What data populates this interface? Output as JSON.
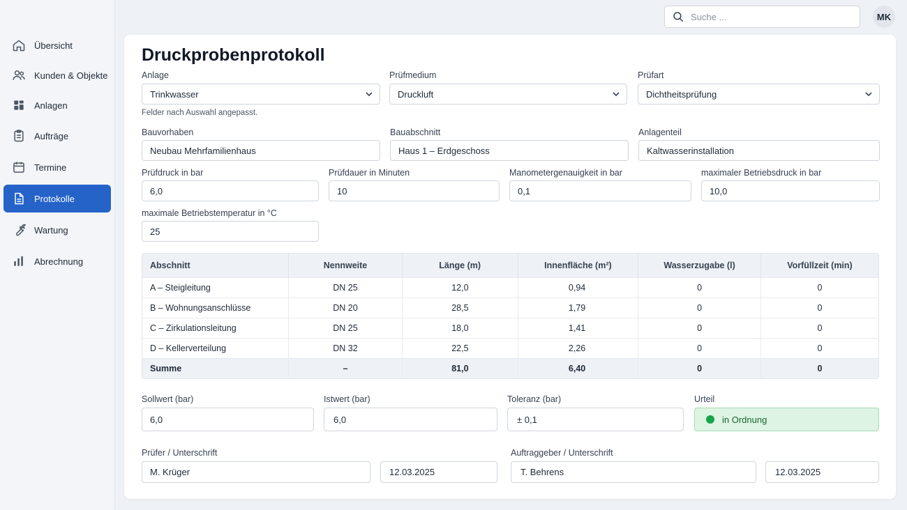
{
  "sidebar": {
    "items": [
      {
        "label": "Übersicht",
        "icon": "home-icon"
      },
      {
        "label": "Kunden & Objekte",
        "icon": "users-icon"
      },
      {
        "label": "Anlagen",
        "icon": "grid-icon"
      },
      {
        "label": "Aufträge",
        "icon": "clipboard-icon"
      },
      {
        "label": "Termine",
        "icon": "calendar-icon"
      },
      {
        "label": "Protokolle",
        "icon": "document-icon",
        "active": true
      },
      {
        "label": "Wartung",
        "icon": "wrench-icon"
      },
      {
        "label": "Abrechnung",
        "icon": "bar-chart-icon"
      }
    ]
  },
  "topbar": {
    "search_placeholder": "Suche ...",
    "avatar_initials": "MK"
  },
  "page": {
    "title": "Druckprobenprotokoll",
    "hint": "Felder nach Auswahl angepasst."
  },
  "selects": {
    "anlage": {
      "label": "Anlage",
      "value": "Trinkwasser"
    },
    "pruefmedium": {
      "label": "Prüfmedium",
      "value": "Druckluft"
    },
    "pruefart": {
      "label": "Prüfart",
      "value": "Dichtheitsprüfung"
    }
  },
  "fields": {
    "bauvorhaben": {
      "label": "Bauvorhaben",
      "value": "Neubau Mehrfamilienhaus"
    },
    "bauabschnitt": {
      "label": "Bauabschnitt",
      "value": "Haus 1 – Erdgeschoss"
    },
    "anlagenteil": {
      "label": "Anlagenteil",
      "value": "Kaltwasserinstallation"
    },
    "pruefdruck": {
      "label": "Prüfdruck in bar",
      "value": "6,0"
    },
    "pruefdauer": {
      "label": "Prüfdauer in Minuten",
      "value": "10"
    },
    "manometer": {
      "label": "Manometergenauigkeit in bar",
      "value": "0,1"
    },
    "max_druck": {
      "label": "maximaler Betriebsdruck in bar",
      "value": "10,0"
    },
    "max_temp": {
      "label": "maximale Betriebstemperatur in °C",
      "value": "25"
    }
  },
  "table": {
    "headers": [
      "Abschnitt",
      "Nennweite",
      "Länge (m)",
      "Innenfläche (m²)",
      "Wasserzugabe (l)",
      "Vorfüllzeit (min)"
    ],
    "rows": [
      [
        "A – Steigleitung",
        "DN 25",
        "12,0",
        "0,94",
        "0",
        "0"
      ],
      [
        "B – Wohnungsanschlüsse",
        "DN 20",
        "28,5",
        "1,79",
        "0",
        "0"
      ],
      [
        "C – Zirkulationsleitung",
        "DN 25",
        "18,0",
        "1,41",
        "0",
        "0"
      ],
      [
        "D – Kellerverteilung",
        "DN 32",
        "22,5",
        "2,26",
        "0",
        "0"
      ]
    ],
    "sum": [
      "Summe",
      "–",
      "81,0",
      "6,40",
      "0",
      "0"
    ]
  },
  "results": {
    "sollwert": {
      "label": "Sollwert (bar)",
      "value": "6,0"
    },
    "istwert": {
      "label": "Istwert (bar)",
      "value": "6,0"
    },
    "toleranz": {
      "label": "Toleranz (bar)",
      "value": "± 0,1"
    },
    "urteil": {
      "label": "Urteil",
      "value": "in Ordnung",
      "color": "#16a34a"
    }
  },
  "signatures": {
    "pruefer": {
      "label": "Prüfer / Unterschrift",
      "name": "M. Krüger",
      "date": "12.03.2025"
    },
    "auftraggeber": {
      "label": "Auftraggeber / Unterschrift",
      "name": "T. Behrens",
      "date": "12.03.2025"
    }
  },
  "colors": {
    "accent": "#2563c9",
    "ok": "#16a34a"
  }
}
